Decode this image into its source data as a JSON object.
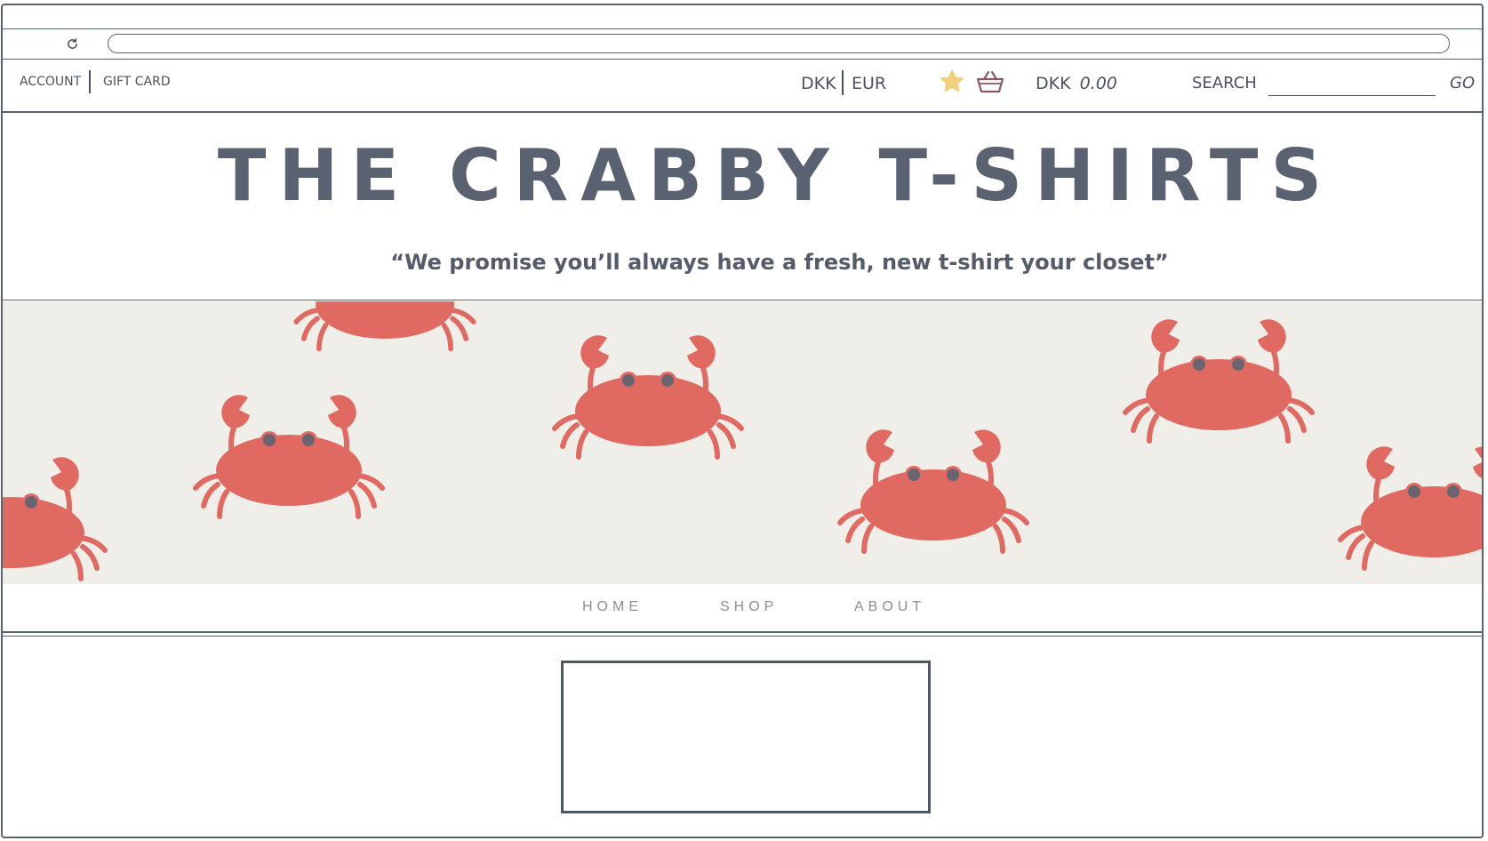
{
  "browser": {
    "reload_icon": "reload-icon",
    "url": ""
  },
  "utility": {
    "account_label": "ACCOUNT",
    "gift_card_label": "GIFT CARD",
    "currency_dkk": "DKK",
    "currency_eur": "EUR",
    "wishlist_icon": "star-icon",
    "cart_icon": "basket-icon",
    "cart_currency": "DKK",
    "cart_amount": "0.00",
    "search_label": "SEARCH",
    "search_value": "",
    "go_label": "GO"
  },
  "header": {
    "brand": "THE CRABBY T-SHIRTS",
    "tagline": "“We promise you’ll always have a fresh, new t-shirt your closet”"
  },
  "banner": {
    "pattern": "crab-pattern",
    "background": "#f0eee9",
    "crab_color": "#e06a61"
  },
  "nav": {
    "items": [
      "HOME",
      "SHOP",
      "ABOUT"
    ]
  },
  "colors": {
    "ink": "#4a5160",
    "brand_text": "#5a6171",
    "nav_text": "#8a8e96",
    "star": "#f1d07c",
    "basket": "#8a5a64"
  }
}
